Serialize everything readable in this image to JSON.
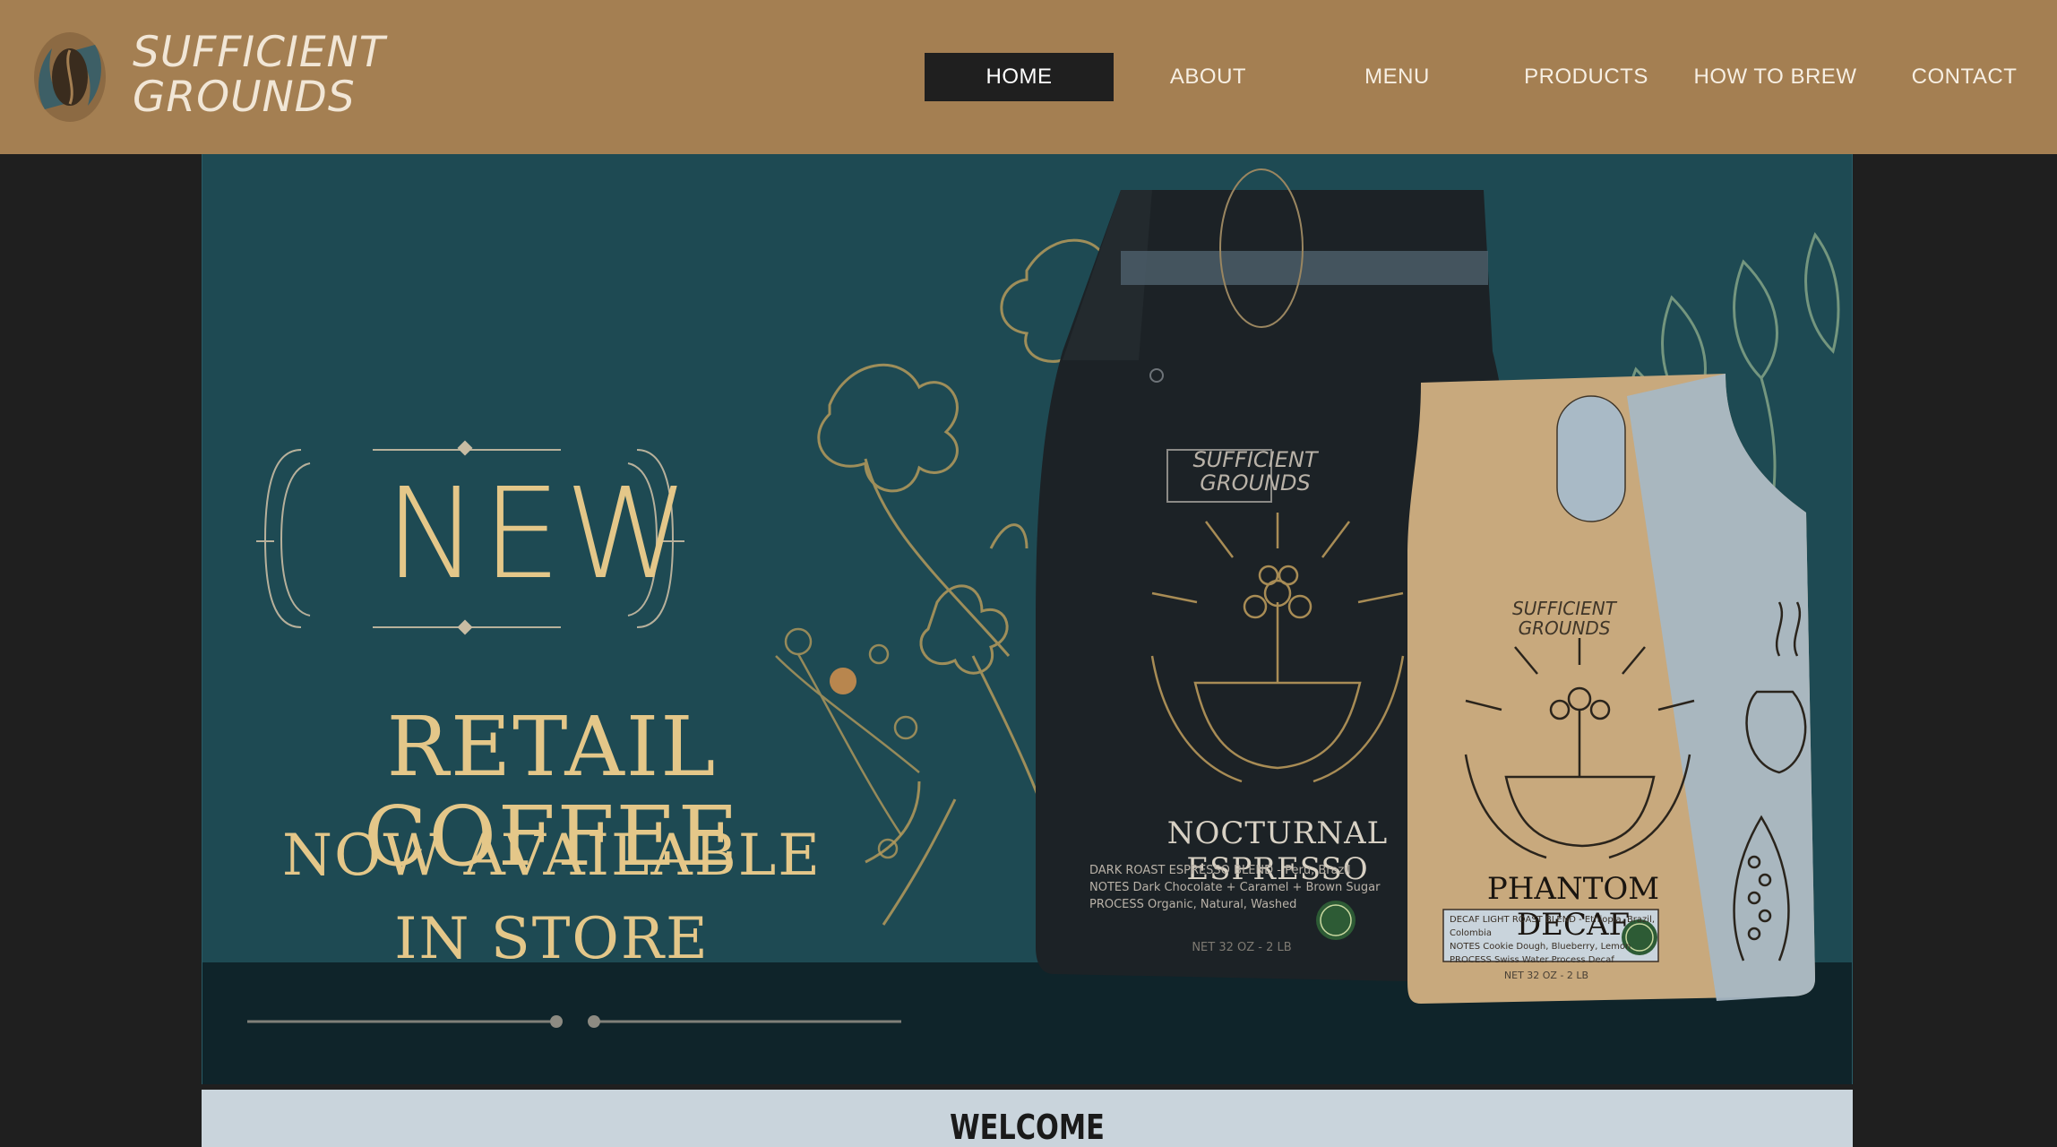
{
  "brand": {
    "name_line1": "SUFFICIENT",
    "name_line2": "GROUNDS",
    "logo_icon": "coffee-bean-hands-icon"
  },
  "nav": {
    "items": [
      {
        "label": "HOME",
        "active": true
      },
      {
        "label": "ABOUT",
        "active": false
      },
      {
        "label": "MENU",
        "active": false
      },
      {
        "label": "PRODUCTS",
        "active": false
      },
      {
        "label": "HOW TO BREW",
        "active": false
      },
      {
        "label": "CONTACT",
        "active": false
      }
    ]
  },
  "hero": {
    "badge": "NEW",
    "headline": "RETAIL COFFEE",
    "subline1": "NOW AVAILABLE",
    "subline2": "IN STORE",
    "products": [
      {
        "brand": "SUFFICIENT GROUNDS",
        "name": "NOCTURNAL ESPRESSO",
        "notes_lines": [
          "DARK ROAST ESPRESSO BLEND - Peru, Brazil",
          "NOTES  Dark Chocolate + Caramel + Brown Sugar",
          "PROCESS Organic, Natural, Washed"
        ],
        "badge": "ORGANIC",
        "net": "NET 32 OZ - 2 LB"
      },
      {
        "brand": "SUFFICIENT GROUNDS",
        "name": "PHANTOM DECAF",
        "notes_lines": [
          "DECAF LIGHT ROAST BLEND - Ethiopia, Brazil, Colombia",
          "NOTES  Cookie Dough, Blueberry, Lemon",
          "PROCESS Swiss Water Process Decaf"
        ],
        "badge": "ORGANIC",
        "net": "NET 32 OZ - 2 LB"
      }
    ]
  },
  "welcome": {
    "title": "WELCOME"
  },
  "colors": {
    "header_bg": "#a47f52",
    "page_bg": "#1f1f1f",
    "hero_bg": "#1e4a53",
    "gold": "#e4c789",
    "welcome_bg": "#c9d4dc"
  }
}
